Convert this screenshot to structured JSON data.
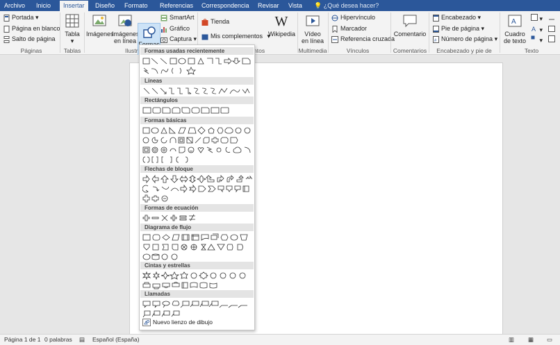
{
  "tabs": [
    "Archivo",
    "Inicio",
    "Insertar",
    "Diseño",
    "Formato",
    "Referencias",
    "Correspondencia",
    "Revisar",
    "Vista"
  ],
  "tell_me": "¿Qué desea hacer?",
  "ribbon": {
    "pages": {
      "portada": "Portada",
      "blank": "Página en blanco",
      "break": "Salto de página",
      "group": "Páginas"
    },
    "tables": {
      "table": "Tabla",
      "group": "Tablas"
    },
    "illus": {
      "images": "Imágenes",
      "online": "Imágenes en línea",
      "shapes": "Formas",
      "smartart": "SmartArt",
      "chart": "Gráfico",
      "capture": "Captura",
      "group": "Ilustr"
    },
    "addins": {
      "store": "Tienda",
      "mine": "Mis complementos",
      "wiki": "Wikipedia",
      "group": "ntos"
    },
    "media": {
      "video": "Vídeo en línea",
      "group": "Multimedia"
    },
    "links": {
      "hyper": "Hipervínculo",
      "bookmark": "Marcador",
      "cross": "Referencia cruzada",
      "group": "Vínculos"
    },
    "comments": {
      "comment": "Comentario",
      "group": "Comentarios"
    },
    "hf": {
      "header": "Encabezado",
      "footer": "Pie de página",
      "pagenum": "Número de página",
      "group": "Encabezado y pie de página"
    },
    "text": {
      "textbox": "Cuadro de texto",
      "group": "Texto"
    }
  },
  "shapes_menu": {
    "sections": [
      "Formas usadas recientemente",
      "Líneas",
      "Rectángulos",
      "Formas básicas",
      "Flechas de bloque",
      "Formas de ecuación",
      "Diagrama de flujo",
      "Cintas y estrellas",
      "Llamadas"
    ],
    "new_canvas": "Nuevo lienzo de dibujo"
  },
  "status": {
    "page": "Página 1 de 1",
    "words": "0 palabras",
    "lang": "Español (España)"
  },
  "colors": {
    "accent": "#2b579a",
    "ribbon": "#f3f3f3"
  }
}
